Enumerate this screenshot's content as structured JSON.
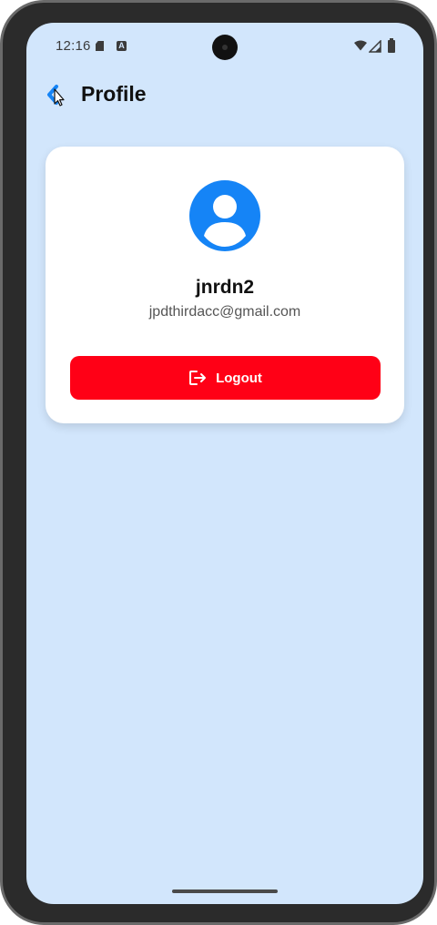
{
  "status_bar": {
    "time": "12:16",
    "a_badge": "A",
    "icons": [
      "sd-card-icon",
      "a-notification-icon",
      "wifi-icon",
      "signal-icon",
      "battery-icon"
    ]
  },
  "header": {
    "title": "Profile",
    "back_icon": "back-arrow-icon"
  },
  "profile": {
    "username": "jnrdn2",
    "email": "jpdthirdacc@gmail.com",
    "avatar_icon": "user-avatar-icon"
  },
  "actions": {
    "logout_label": "Logout",
    "logout_icon": "logout-icon"
  },
  "colors": {
    "background": "#d2e6fc",
    "card": "#ffffff",
    "accent": "#1584f6",
    "logout": "#ff0016"
  }
}
